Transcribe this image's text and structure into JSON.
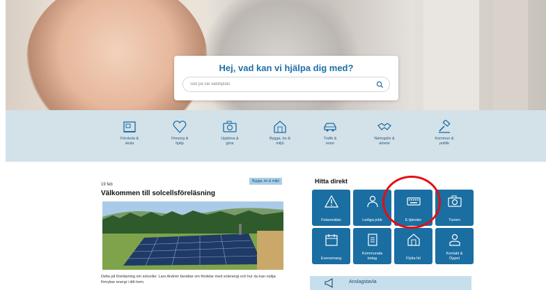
{
  "search": {
    "heading": "Hej, vad kan vi hjälpa dig med?",
    "placeholder": "Sök på vår webbplats",
    "icon": "search-icon"
  },
  "categories": [
    {
      "label": "Förskola &\nskola",
      "icon": "school-icon"
    },
    {
      "label": "Omsorg &\nhjälp",
      "icon": "heart-icon"
    },
    {
      "label": "Uppleva &\ngöra",
      "icon": "camera-icon"
    },
    {
      "label": "Bygga, bo &\nmiljö",
      "icon": "house-icon"
    },
    {
      "label": "Trafik &\nresor",
      "icon": "car-icon"
    },
    {
      "label": "Näringsliv &\narbete",
      "icon": "handshake-icon"
    },
    {
      "label": "Kommun &\npolitik",
      "icon": "gavel-icon"
    }
  ],
  "news": {
    "tag": "Bygga, bo & miljö",
    "date": "19 feb",
    "title": "Välkommen till solcellsföreläsning",
    "text": "Delta på föreläsning om solceller. Lars Andrén berättar om fördelar med solenergi och hur du kan nyttja förnybar energi i ditt hem."
  },
  "quick": {
    "heading": "Hitta direkt",
    "tiles": [
      {
        "label": "Felanmälan",
        "icon": "warning-icon"
      },
      {
        "label": "Lediga jobb",
        "icon": "people-icon"
      },
      {
        "label": "E-tjänster",
        "icon": "keyboard-icon"
      },
      {
        "label": "Turism",
        "icon": "camera-icon"
      },
      {
        "label": "Evenemang",
        "icon": "calendar-icon"
      },
      {
        "label": "Kommunala\nbolag",
        "icon": "document-icon"
      },
      {
        "label": "Flytta hit",
        "icon": "house-icon"
      },
      {
        "label": "Kontakt &\nÖppet",
        "icon": "person-icon"
      }
    ]
  },
  "board": {
    "label": "Anslagstavla",
    "icon": "megaphone-icon"
  },
  "colors": {
    "brand": "#1a6ea2",
    "heading": "#1e6fa8",
    "catbar": "#d3e1e9",
    "highlight": "#e40d10"
  }
}
